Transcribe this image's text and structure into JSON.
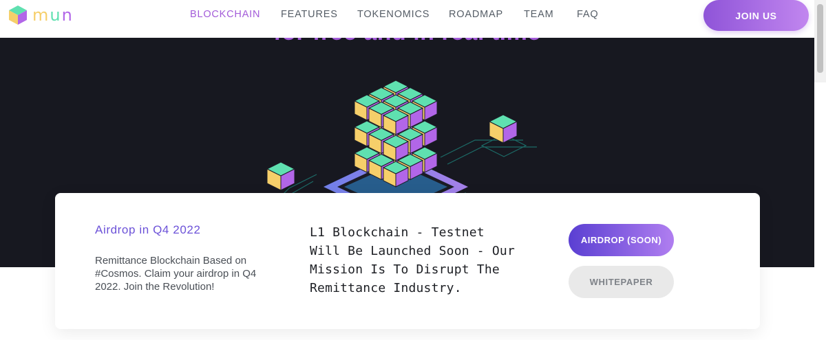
{
  "header": {
    "logo_text": "mun",
    "logo_letters": [
      "m",
      "u",
      "n"
    ],
    "nav": [
      {
        "label": "BLOCKCHAIN",
        "active": true
      },
      {
        "label": "FEATURES",
        "active": false
      },
      {
        "label": "TOKENOMICS",
        "active": false
      },
      {
        "label": "ROADMAP",
        "active": false
      },
      {
        "label": "TEAM",
        "active": false
      },
      {
        "label": "FAQ",
        "active": false
      }
    ],
    "join_label": "JOIN US"
  },
  "hero": {
    "title_partial": "for free and in real time"
  },
  "card": {
    "airdrop_heading": "Airdrop in Q4 2022",
    "airdrop_description": "Remittance Blockchain Based on #Cosmos. Claim your airdrop in Q4 2022. Join the Revolution!",
    "mission": "L1 Blockchain - Testnet Will Be Launched Soon - Our Mission Is To Disrupt The Remittance Industry.",
    "primary_button": "AIRDROP (SOON)",
    "secondary_button": "WHITEPAPER"
  },
  "colors": {
    "accent": "#a35bd9",
    "hero_bg": "#171820",
    "cube_top": "#5fe0b0",
    "cube_left": "#f6cf6a",
    "cube_right": "#b266e8"
  },
  "icons": [
    "logo-cube-icon",
    "blockchain-cubes-illustration"
  ]
}
